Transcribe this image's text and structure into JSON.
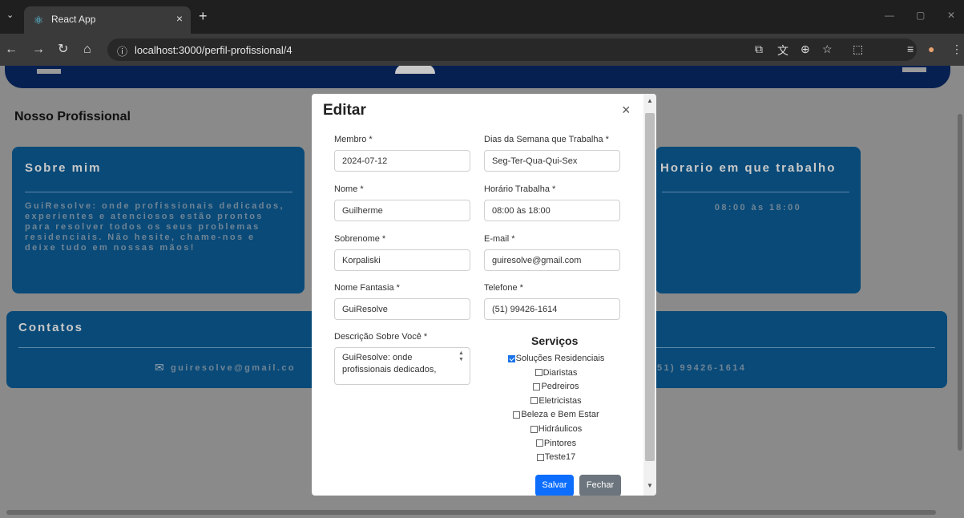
{
  "browser": {
    "tab_title": "React App",
    "tab_close": "×",
    "new_tab": "+",
    "url": "localhost:3000/perfil-profissional/4"
  },
  "page": {
    "section_title": "Nosso Profissional",
    "about": {
      "title": "Sobre mim",
      "text": "GuiResolve: onde profissionais dedicados, experientes e atenciosos estão prontos para resolver todos os seus problemas residenciais. Não hesite, chame-nos e deixe tudo em nossas mãos!"
    },
    "schedule": {
      "title": "Horario em que trabalho",
      "hours": "08:00 às 18:00"
    },
    "contacts": {
      "title": "Contatos",
      "email": "guiresolve@gmail.co",
      "phone": "51) 99426-1614"
    }
  },
  "modal": {
    "title": "Editar",
    "close": "×",
    "fields": {
      "membro": {
        "label": "Membro *",
        "value": "2024-07-12"
      },
      "dias": {
        "label": "Dias da Semana que Trabalha *",
        "value": "Seg-Ter-Qua-Qui-Sex"
      },
      "nome": {
        "label": "Nome *",
        "value": "Guilherme"
      },
      "horario": {
        "label": "Horário Trabalha *",
        "value": "08:00 às 18:00"
      },
      "sobrenome": {
        "label": "Sobrenome *",
        "value": "Korpaliski"
      },
      "email": {
        "label": "E-mail *",
        "value": "guiresolve@gmail.com"
      },
      "fantasia": {
        "label": "Nome Fantasia *",
        "value": "GuiResolve"
      },
      "telefone": {
        "label": "Telefone *",
        "value": "(51) 99426-1614"
      },
      "descricao": {
        "label": "Descrição Sobre Você *",
        "value": "GuiResolve: onde profissionais dedicados,"
      }
    },
    "services": {
      "title": "Serviços",
      "items": [
        {
          "label": "Soluções Residenciais",
          "checked": true
        },
        {
          "label": "Diaristas",
          "checked": false
        },
        {
          "label": "Pedreiros",
          "checked": false
        },
        {
          "label": "Eletricistas",
          "checked": false
        },
        {
          "label": "Beleza e Bem Estar",
          "checked": false
        },
        {
          "label": "Hidráulicos",
          "checked": false
        },
        {
          "label": "Pintores",
          "checked": false
        },
        {
          "label": "Teste17",
          "checked": false
        }
      ]
    },
    "save_label": "Salvar",
    "close_label": "Fechar"
  }
}
